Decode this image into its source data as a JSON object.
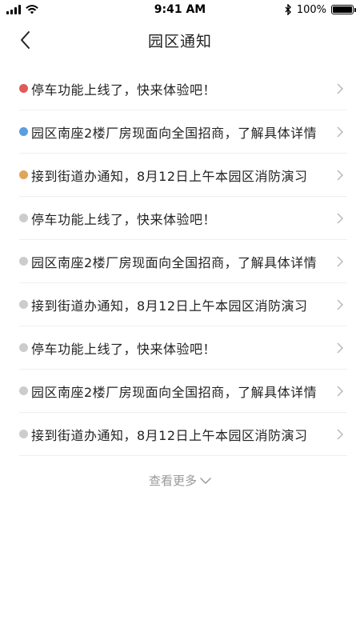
{
  "status_bar": {
    "time": "9:41 AM",
    "battery": "100%",
    "battery_level": 1.0
  },
  "nav": {
    "title": "园区通知"
  },
  "notices": [
    {
      "text": "停车功能上线了，快来体验吧！",
      "dot_color": "#e05a5a",
      "status": "unread-urgent"
    },
    {
      "text": "园区南座2楼厂房现面向全国招商，了解具体详情",
      "dot_color": "#5a9ee0",
      "status": "unread-info"
    },
    {
      "text": "接到街道办通知，8月12日上午本园区消防演习",
      "dot_color": "#e0a55a",
      "status": "unread-notice"
    },
    {
      "text": "停车功能上线了，快来体验吧！",
      "dot_color": "#cccccc",
      "status": "read"
    },
    {
      "text": "园区南座2楼厂房现面向全国招商，了解具体详情",
      "dot_color": "#cccccc",
      "status": "read"
    },
    {
      "text": "接到街道办通知，8月12日上午本园区消防演习",
      "dot_color": "#cccccc",
      "status": "read"
    },
    {
      "text": "停车功能上线了，快来体验吧！",
      "dot_color": "#cccccc",
      "status": "read"
    },
    {
      "text": "园区南座2楼厂房现面向全国招商，了解具体详情",
      "dot_color": "#cccccc",
      "status": "read"
    },
    {
      "text": "接到街道办通知，8月12日上午本园区消防演习",
      "dot_color": "#cccccc",
      "status": "read"
    }
  ],
  "load_more": {
    "label": "查看更多",
    "icon": "chevron-down-icon"
  }
}
